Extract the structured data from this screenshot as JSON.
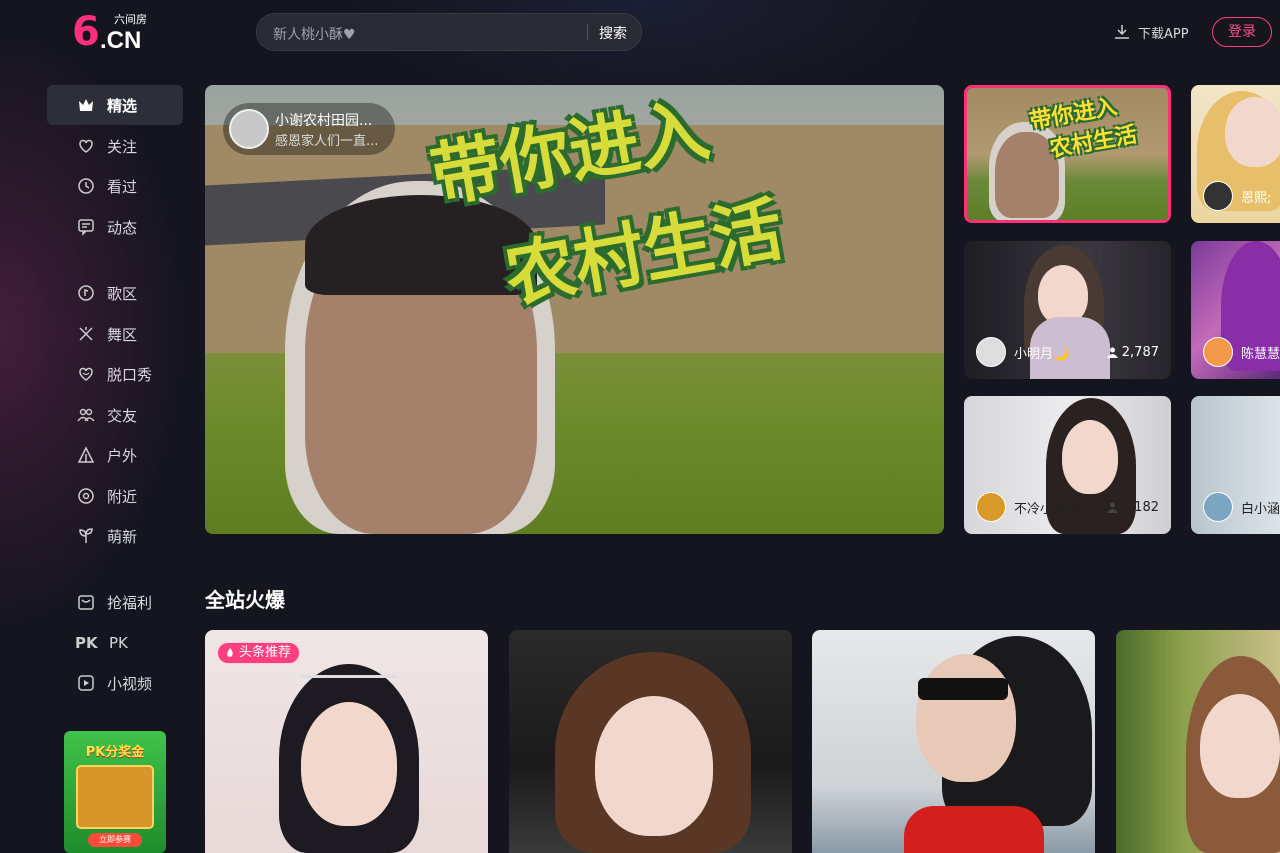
{
  "header": {
    "logo_mark": "6",
    "logo_text": ".CN",
    "logo_sub": "六间房",
    "search_placeholder": "新人桃小酥♥",
    "search_button": "搜索",
    "download_label": "下载APP",
    "login_label": "登录"
  },
  "sidebar": {
    "items": [
      {
        "label": "精选",
        "icon": "crown-icon",
        "active": true
      },
      {
        "label": "关注",
        "icon": "heart-icon"
      },
      {
        "label": "看过",
        "icon": "clock-icon"
      },
      {
        "label": "动态",
        "icon": "message-icon"
      },
      {
        "label": "歌区",
        "icon": "music-icon"
      },
      {
        "label": "舞区",
        "icon": "dance-icon"
      },
      {
        "label": "脱口秀",
        "icon": "smile-icon"
      },
      {
        "label": "交友",
        "icon": "friends-icon"
      },
      {
        "label": "户外",
        "icon": "tent-icon"
      },
      {
        "label": "附近",
        "icon": "location-icon"
      },
      {
        "label": "萌新",
        "icon": "sprout-icon"
      },
      {
        "label": "抢福利",
        "icon": "gift-icon"
      },
      {
        "label": "PK",
        "icon": "pk-icon"
      },
      {
        "label": "小视频",
        "icon": "video-icon"
      }
    ],
    "promo": {
      "title": "PK分奖金",
      "button": "立即参赛"
    }
  },
  "hero": {
    "title_line1": "带你进入",
    "title_line2": "农村生活",
    "anchor_name": "小谢农村田园...",
    "anchor_desc": "感恩家人们一直..."
  },
  "rooms": [
    {
      "name": "",
      "viewers": ""
    },
    {
      "name": "恩熙;",
      "viewers": ""
    },
    {
      "name": "小明月🌙",
      "viewers": "2,787"
    },
    {
      "name": "陈慧慧",
      "viewers": ""
    },
    {
      "name": "不冷小妖精",
      "viewers": "5,182"
    },
    {
      "name": "白小涵",
      "viewers": ""
    }
  ],
  "section": {
    "title": "全站火爆",
    "badge": "头条推荐"
  },
  "colors": {
    "accent": "#ff2f7a",
    "background": "#15151f",
    "sidebar_active": "#2e2e39"
  }
}
